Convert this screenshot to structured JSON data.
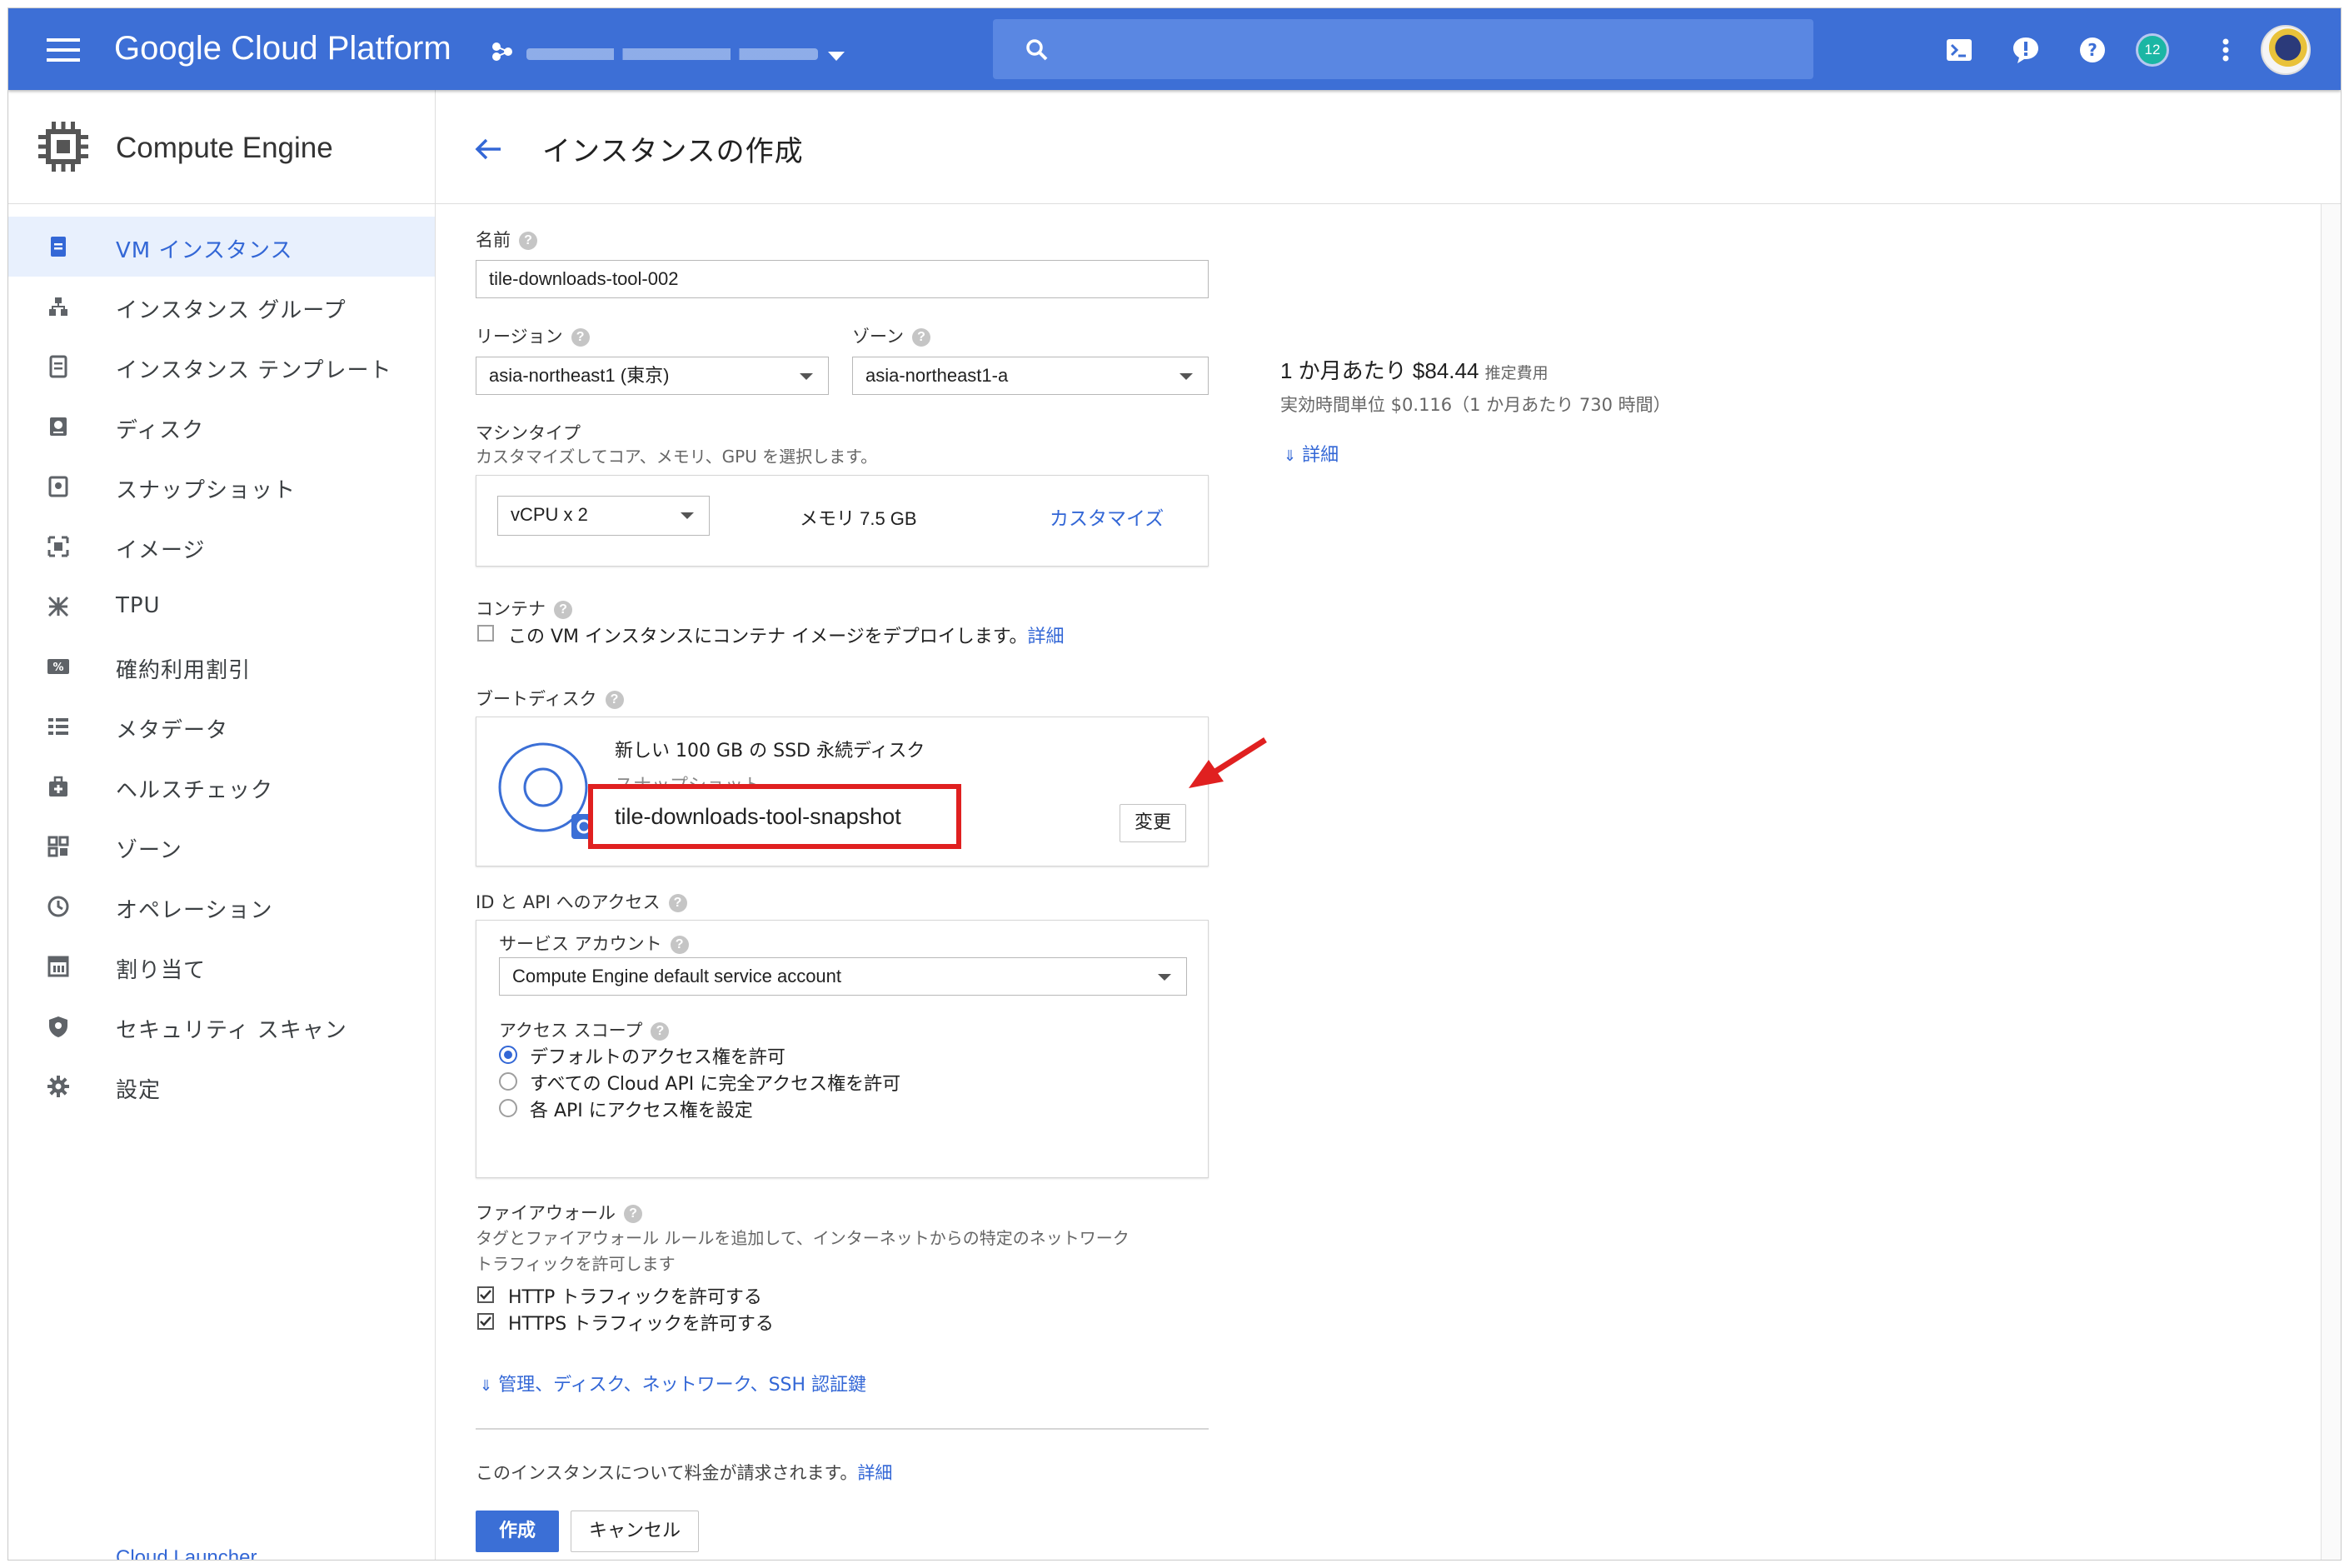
{
  "topbar": {
    "brand": "Google Cloud Platform",
    "search_placeholder": "",
    "notification_count": "12"
  },
  "sidebar": {
    "product_title": "Compute Engine",
    "items": [
      {
        "label": "VM インスタンス",
        "icon": "vm-instance-icon",
        "active": true
      },
      {
        "label": "インスタンス グループ",
        "icon": "instance-group-icon"
      },
      {
        "label": "インスタンス テンプレート",
        "icon": "instance-template-icon"
      },
      {
        "label": "ディスク",
        "icon": "disk-icon"
      },
      {
        "label": "スナップショット",
        "icon": "snapshot-icon"
      },
      {
        "label": "イメージ",
        "icon": "image-icon"
      },
      {
        "label": "TPU",
        "icon": "tpu-icon"
      },
      {
        "label": "確約利用割引",
        "icon": "percent-icon"
      },
      {
        "label": "メタデータ",
        "icon": "metadata-icon"
      },
      {
        "label": "ヘルスチェック",
        "icon": "health-check-icon"
      },
      {
        "label": "ゾーン",
        "icon": "zone-icon"
      },
      {
        "label": "オペレーション",
        "icon": "clock-icon"
      },
      {
        "label": "割り当て",
        "icon": "quota-icon"
      },
      {
        "label": "セキュリティ スキャン",
        "icon": "shield-icon"
      },
      {
        "label": "設定",
        "icon": "gear-icon"
      }
    ],
    "bottom_link": "Cloud Launcher"
  },
  "page": {
    "title": "インスタンスの作成"
  },
  "form": {
    "name": {
      "label": "名前",
      "value": "tile-downloads-tool-002"
    },
    "region": {
      "label": "リージョン",
      "value": "asia-northeast1 (東京)"
    },
    "zone": {
      "label": "ゾーン",
      "value": "asia-northeast1-a"
    },
    "machine": {
      "label": "マシンタイプ",
      "hint": "カスタマイズしてコア、メモリ、GPU を選択します。",
      "vcpu": "vCPU x 2",
      "memory": "メモリ 7.5 GB",
      "customize": "カスタマイズ"
    },
    "container": {
      "label": "コンテナ",
      "option": "この VM インスタンスにコンテナ イメージをデプロイします。",
      "link": "詳細"
    },
    "boot_disk": {
      "label": "ブートディスク",
      "line1": "新しい 100 GB の SSD 永続ディスク",
      "line2": "スナップショット",
      "snapshot": "tile-downloads-tool-snapshot",
      "change": "変更"
    },
    "identity": {
      "label": "ID と API へのアクセス",
      "service_account_label": "サービス アカウント",
      "service_account": "Compute Engine default service account",
      "scope_label": "アクセス スコープ",
      "scopes": [
        {
          "label": "デフォルトのアクセス権を許可",
          "selected": true
        },
        {
          "label": "すべての Cloud API に完全アクセス権を許可",
          "selected": false
        },
        {
          "label": "各 API にアクセス権を設定",
          "selected": false
        }
      ]
    },
    "firewall": {
      "label": "ファイアウォール",
      "hint1": "タグとファイアウォール ルールを追加して、インターネットからの特定のネットワーク",
      "hint2": "トラフィックを許可します",
      "http": "HTTP トラフィックを許可する",
      "https": "HTTPS トラフィックを許可する"
    },
    "advanced_link": "管理、ディスク、ネットワーク、SSH 認証鍵",
    "billing_note": "このインスタンスについて料金が請求されます。",
    "billing_link": "詳細",
    "create": "作成",
    "cancel": "キャンセル"
  },
  "pricing": {
    "monthly": "1 か月あたり $84.44",
    "estimate": "推定費用",
    "hourly": "実効時間単位 $0.116（1 か月あたり 730 時間）",
    "details": "詳細"
  },
  "colors": {
    "topbar": "#3d6fd6",
    "accent": "#3367d6",
    "highlight": "#e02020"
  }
}
